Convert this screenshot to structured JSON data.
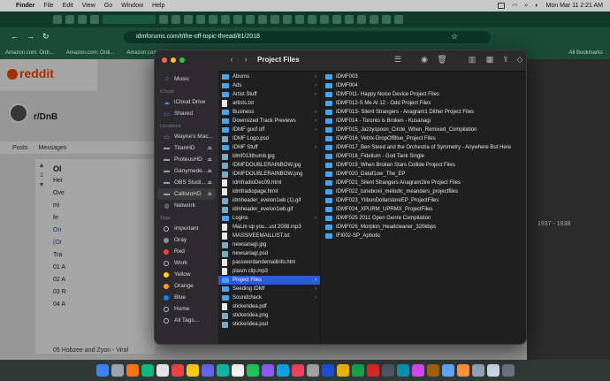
{
  "menubar": {
    "app": "Finder",
    "items": [
      "File",
      "Edit",
      "View",
      "Go",
      "Window",
      "Help"
    ],
    "clock": "Mon Mar 11  2:21 AM"
  },
  "browser": {
    "url": "idmforums.com/t/the-off-topic-thread/81/2018",
    "bookmarks": [
      "Amazon.com: Ordi...",
      "Amazon.com: Ordi...",
      "Amazon.com: Ordi...",
      "All Bookmarks"
    ]
  },
  "reddit": {
    "logo": "reddit",
    "subreddit": "r/DnB",
    "tabs": [
      "Posts",
      "Messages"
    ],
    "post_lines": [
      "Ol",
      "Hel",
      "Ove",
      "mi",
      "fe",
      "On",
      "(Or",
      "Tra",
      "01 A",
      "02 A",
      "03 R",
      "04 A"
    ],
    "vote": "1",
    "footer": "05 Hobzee and Zyon - Viral"
  },
  "forum": {
    "years": "1937 - 1938"
  },
  "finder": {
    "title": "Project Files",
    "sidebar": {
      "favorites": [
        {
          "label": "Music",
          "icon": "music-icon"
        }
      ],
      "icloud_header": "iCloud",
      "icloud": [
        {
          "label": "iCloud Drive",
          "icon": "cloud-icon"
        },
        {
          "label": "Shared",
          "icon": "shared-folder-icon"
        }
      ],
      "locations_header": "Locations",
      "locations": [
        {
          "label": "Wayne's Mac...",
          "icon": "laptop-icon",
          "eject": false
        },
        {
          "label": "TitanHD",
          "icon": "drive-icon",
          "eject": true
        },
        {
          "label": "ProteusHD",
          "icon": "drive-icon",
          "eject": true
        },
        {
          "label": "Ganymede...",
          "icon": "drive-icon",
          "eject": true
        },
        {
          "label": "OBS Studi...",
          "icon": "drive-icon",
          "eject": true
        },
        {
          "label": "CallistoHD",
          "icon": "drive-icon",
          "eject": true,
          "selected": true
        },
        {
          "label": "Network",
          "icon": "globe-icon",
          "eject": false
        }
      ],
      "tags_header": "Tags",
      "tags": [
        {
          "label": "Important",
          "color": "#bbbbbb",
          "hollow": true
        },
        {
          "label": "Gray",
          "color": "#8e8e93"
        },
        {
          "label": "Red",
          "color": "#ff453a"
        },
        {
          "label": "Work",
          "color": "#bbbbbb",
          "hollow": true
        },
        {
          "label": "Yellow",
          "color": "#ffd60a"
        },
        {
          "label": "Orange",
          "color": "#ff9f0a"
        },
        {
          "label": "Blue",
          "color": "#0a84ff"
        },
        {
          "label": "Home",
          "color": "#bbbbbb",
          "hollow": true
        },
        {
          "label": "All Tags...",
          "color": "#bbbbbb",
          "hollow": true
        }
      ]
    },
    "column1": [
      {
        "name": "Aburns",
        "type": "folder",
        "chevron": true
      },
      {
        "name": "Ads",
        "type": "folder",
        "chevron": true
      },
      {
        "name": "Artist Stuff",
        "type": "folder",
        "chevron": true
      },
      {
        "name": "artists.txt",
        "type": "file"
      },
      {
        "name": "Business",
        "type": "folder",
        "chevron": true
      },
      {
        "name": "Downsized Track Previews",
        "type": "folder",
        "chevron": true
      },
      {
        "name": "IDMF goof off",
        "type": "folder",
        "chevron": true
      },
      {
        "name": "IDMF Logo.psd",
        "type": "img"
      },
      {
        "name": "IDMF Stuff",
        "type": "folder",
        "chevron": true
      },
      {
        "name": "idmf013thumb.jpg",
        "type": "img"
      },
      {
        "name": "IDMFDOUBLERAINBOW.jpg",
        "type": "img"
      },
      {
        "name": "IDMFDOUBLERAINBOW.png",
        "type": "img"
      },
      {
        "name": "IdmfradioDec09.html",
        "type": "file"
      },
      {
        "name": "idmfradiopage.html",
        "type": "file"
      },
      {
        "name": "idmheader_evelon1wb (1).gif",
        "type": "img"
      },
      {
        "name": "idmheader_evelon1wb.gif",
        "type": "img"
      },
      {
        "name": "Logins",
        "type": "folder",
        "chevron": true
      },
      {
        "name": "MaLm up you...ust 2008.mp3",
        "type": "file"
      },
      {
        "name": "MASSIVEEMAILLIST.txt",
        "type": "file"
      },
      {
        "name": "newsanagi.jpg",
        "type": "img"
      },
      {
        "name": "newsanagi.psd",
        "type": "img"
      },
      {
        "name": "passwordandemailinfo.htm",
        "type": "file"
      },
      {
        "name": "plasm clip.mp3",
        "type": "file"
      },
      {
        "name": "Project Files",
        "type": "folder",
        "chevron": true,
        "selected": true
      },
      {
        "name": "Seeding IDMf",
        "type": "folder",
        "chevron": true
      },
      {
        "name": "Soundcheck",
        "type": "folder",
        "chevron": true
      },
      {
        "name": "stickeridea.pdf",
        "type": "file"
      },
      {
        "name": "stickeridea.png",
        "type": "img"
      },
      {
        "name": "stickeridea.psd",
        "type": "img"
      }
    ],
    "column2": [
      "IDMF003",
      "IDMF004",
      "IDMF011- Happy Noise Device Project Files",
      "IDMF012-S Me At 12 - Odd Project Files",
      "IDMF013- Silent Strangers - Anagram1 Dither Project Files",
      "IDMF014 - Toronto is Broken - Kusanagi",
      "IDMF015_Jazzyspoon_Circle_When_Remixed_Compilation",
      "IDMF016_Vetrix-DropOfBlue_Project Files",
      "IDMF017_Ben Steed and the Orchestra of Symmetry - Anywhere But Here",
      "IDMF018_Fidelium - God Tank Single",
      "IDMF019_When Broken Stars Collide Project Files",
      "IDMF020_Dataf1ow_The_EP",
      "IDMF021_Silent Strangers Anagram2ire Project Files",
      "IDMF022_tuneboxii_melodic_meanders_projectfiles",
      "IDMF023_YlibonDollarstoreEP_ProjectFiles",
      "IDMF024_XPURM_UPRMX_ProjectFiles",
      "IDMF025 2011 Open Genre Compilation",
      "IDMF026_Morplon_Headcleaner_320kbps",
      "IFI002-SP_Aphotic"
    ]
  }
}
